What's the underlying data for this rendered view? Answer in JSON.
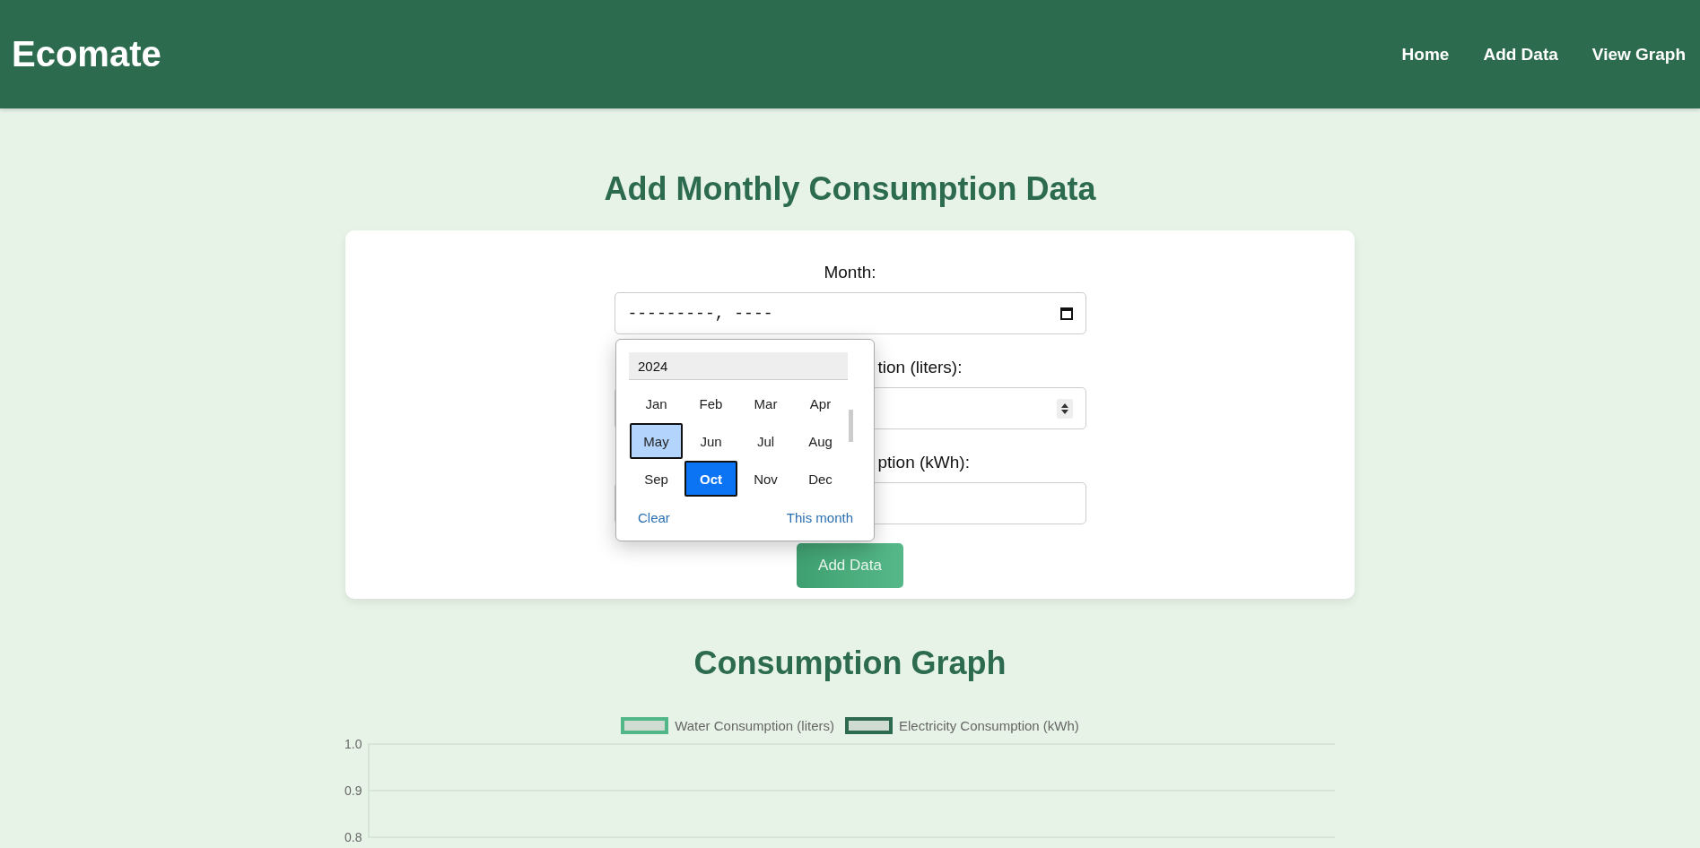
{
  "header": {
    "logo": "Ecomate",
    "nav": [
      {
        "label": "Home"
      },
      {
        "label": "Add Data"
      },
      {
        "label": "View Graph"
      }
    ]
  },
  "form": {
    "title": "Add Monthly Consumption Data",
    "fields": [
      {
        "kind": "month",
        "label": "Month:",
        "value": "---------, ----"
      },
      {
        "kind": "number",
        "label": "tion (liters):"
      },
      {
        "kind": "text",
        "label": "ption (kWh):"
      }
    ],
    "submit": "Add Data"
  },
  "month_picker": {
    "year": "2024",
    "months": [
      {
        "label": "Jan",
        "selected": false,
        "hovered": false
      },
      {
        "label": "Feb",
        "selected": false,
        "hovered": false
      },
      {
        "label": "Mar",
        "selected": false,
        "hovered": false
      },
      {
        "label": "Apr",
        "selected": false,
        "hovered": false
      },
      {
        "label": "May",
        "selected": false,
        "hovered": true
      },
      {
        "label": "Jun",
        "selected": false,
        "hovered": false
      },
      {
        "label": "Jul",
        "selected": false,
        "hovered": false
      },
      {
        "label": "Aug",
        "selected": false,
        "hovered": false
      },
      {
        "label": "Sep",
        "selected": false,
        "hovered": false
      },
      {
        "label": "Oct",
        "selected": true,
        "hovered": false
      },
      {
        "label": "Nov",
        "selected": false,
        "hovered": false
      },
      {
        "label": "Dec",
        "selected": false,
        "hovered": false
      }
    ],
    "actions": [
      "Clear",
      "This month"
    ]
  },
  "graph": {
    "title": "Consumption Graph",
    "chart_data": {
      "type": "line",
      "ylim": [
        0.8,
        1.0
      ],
      "yticks": [
        {
          "value": 1.0,
          "label": "1.0"
        },
        {
          "value": 0.9,
          "label": "0.9"
        },
        {
          "value": 0.8,
          "label": "0.8"
        }
      ],
      "series": [
        {
          "name": "Water Consumption (liters)",
          "color": "#52b788"
        },
        {
          "name": "Electricity Consumption (kWh)",
          "color": "#2d6a4f"
        }
      ]
    }
  }
}
